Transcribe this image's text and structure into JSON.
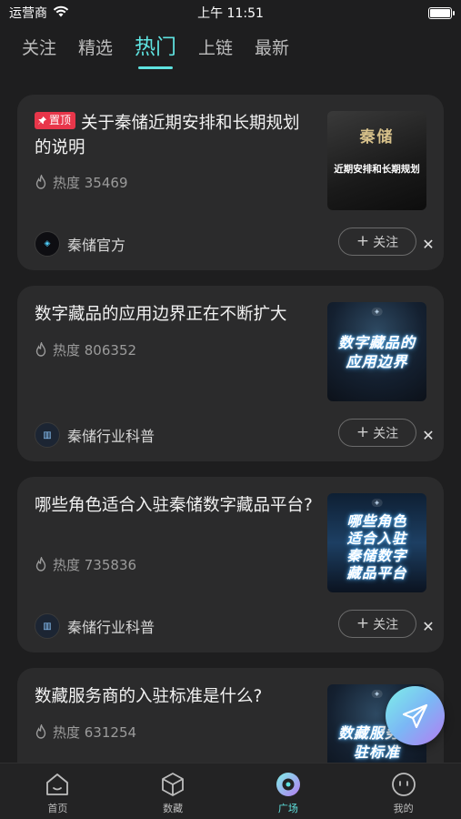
{
  "status_bar": {
    "carrier": "运营商",
    "time": "上午 11:51",
    "battery_level": 1.0
  },
  "tabs": [
    {
      "label": "关注",
      "active": false
    },
    {
      "label": "精选",
      "active": false
    },
    {
      "label": "热门",
      "active": true
    },
    {
      "label": "上链",
      "active": false
    },
    {
      "label": "最新",
      "active": false
    }
  ],
  "posts": [
    {
      "pinned_label": "置顶",
      "title": "关于秦储近期安排和长期规划的说明",
      "heat_label": "热度 35469",
      "thumb_text": "近期安排和长期规划",
      "thumb_logo": "秦储",
      "author": "秦储官方",
      "follow_label": "关注"
    },
    {
      "title": "数字藏品的应用边界正在不断扩大",
      "heat_label": "热度 806352",
      "thumb_text": "数字藏品的应用边界",
      "author": "秦储行业科普",
      "follow_label": "关注"
    },
    {
      "title": "哪些角色适合入驻秦储数字藏品平台?",
      "heat_label": "热度 735836",
      "thumb_text": "哪些角色适合入驻秦储数字藏品平台",
      "author": "秦储行业科普",
      "follow_label": "关注"
    },
    {
      "title": "数藏服务商的入驻标准是什么?",
      "heat_label": "热度 631254",
      "thumb_text": "数藏服务入驻标准"
    }
  ],
  "bottom_nav": [
    {
      "label": "首页",
      "icon": "home-icon",
      "active": false
    },
    {
      "label": "数藏",
      "icon": "box-icon",
      "active": false
    },
    {
      "label": "广场",
      "icon": "chat-bubble-icon",
      "active": true
    },
    {
      "label": "我的",
      "icon": "profile-face-icon",
      "active": false
    }
  ],
  "colors": {
    "accent": "#5fe3e0",
    "pin_badge": "#e8364a",
    "card_bg": "#2b2b2c",
    "page_bg": "#1e1e1f"
  }
}
